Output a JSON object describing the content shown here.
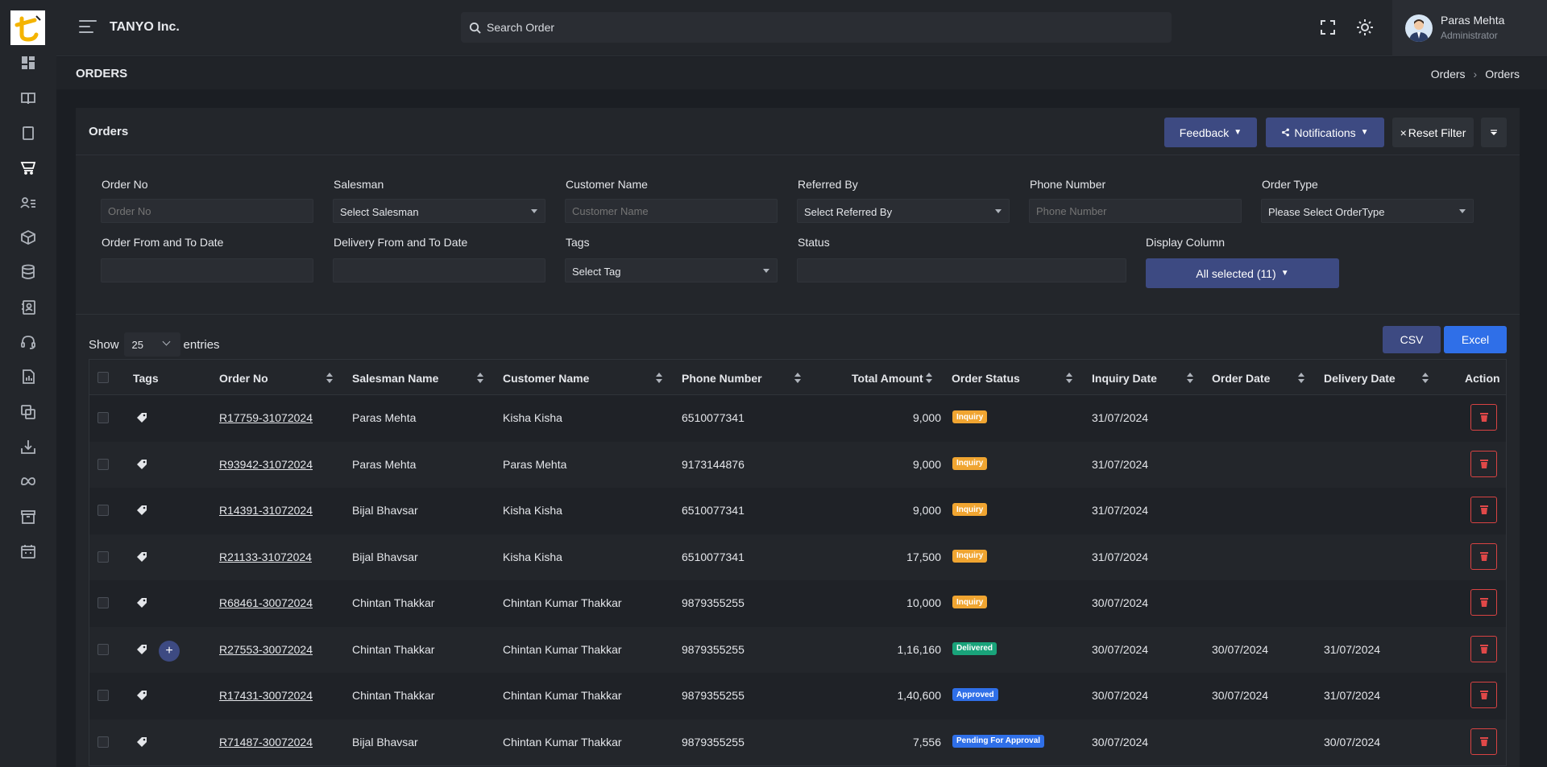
{
  "app": {
    "brand": "TANYO Inc."
  },
  "search": {
    "placeholder": "Search Order"
  },
  "user": {
    "name": "Paras Mehta",
    "role": "Administrator"
  },
  "page": {
    "title": "ORDERS",
    "breadcrumb": [
      "Orders",
      "Orders"
    ]
  },
  "card": {
    "title": "Orders",
    "feedback_label": "Feedback",
    "notifications_label": "Notifications",
    "reset_label": "Reset Filter",
    "reset_symbol": "×"
  },
  "filters": {
    "order_no": {
      "label": "Order No",
      "placeholder": "Order No"
    },
    "salesman": {
      "label": "Salesman",
      "value": "Select Salesman"
    },
    "customer_name": {
      "label": "Customer Name",
      "placeholder": "Customer Name"
    },
    "referred_by": {
      "label": "Referred By",
      "value": "Select Referred By"
    },
    "phone_number": {
      "label": "Phone Number",
      "placeholder": "Phone Number"
    },
    "order_type": {
      "label": "Order Type",
      "value": "Please Select OrderType"
    },
    "order_date": {
      "label": "Order From and To Date"
    },
    "delivery_date": {
      "label": "Delivery From and To Date"
    },
    "tags": {
      "label": "Tags",
      "value": "Select Tag"
    },
    "status": {
      "label": "Status"
    },
    "display_column": {
      "label": "Display Column",
      "value": "All selected (11)"
    }
  },
  "table_controls": {
    "show_label": "Show",
    "entries_value": "25",
    "entries_label": "entries",
    "csv_label": "CSV",
    "excel_label": "Excel"
  },
  "table": {
    "columns": [
      "Tags",
      "Order No",
      "Salesman Name",
      "Customer Name",
      "Phone Number",
      "Total Amount",
      "Order Status",
      "Inquiry Date",
      "Order Date",
      "Delivery Date",
      "Action"
    ],
    "rows": [
      {
        "order_no": "R17759-31072024",
        "salesman": "Paras Mehta",
        "customer": "Kisha Kisha",
        "phone": "6510077341",
        "amount": "9,000",
        "status": "Inquiry",
        "status_type": "inquiry",
        "inquiry_date": "31/07/2024",
        "order_date": "",
        "delivery_date": "",
        "has_plus": false
      },
      {
        "order_no": "R93942-31072024",
        "salesman": "Paras Mehta",
        "customer": "Paras Mehta",
        "phone": "9173144876",
        "amount": "9,000",
        "status": "Inquiry",
        "status_type": "inquiry",
        "inquiry_date": "31/07/2024",
        "order_date": "",
        "delivery_date": "",
        "has_plus": false
      },
      {
        "order_no": "R14391-31072024",
        "salesman": "Bijal Bhavsar",
        "customer": "Kisha Kisha",
        "phone": "6510077341",
        "amount": "9,000",
        "status": "Inquiry",
        "status_type": "inquiry",
        "inquiry_date": "31/07/2024",
        "order_date": "",
        "delivery_date": "",
        "has_plus": false
      },
      {
        "order_no": "R21133-31072024",
        "salesman": "Bijal Bhavsar",
        "customer": "Kisha Kisha",
        "phone": "6510077341",
        "amount": "17,500",
        "status": "Inquiry",
        "status_type": "inquiry",
        "inquiry_date": "31/07/2024",
        "order_date": "",
        "delivery_date": "",
        "has_plus": false
      },
      {
        "order_no": "R68461-30072024",
        "salesman": "Chintan Thakkar",
        "customer": "Chintan Kumar Thakkar",
        "phone": "9879355255",
        "amount": "10,000",
        "status": "Inquiry",
        "status_type": "inquiry",
        "inquiry_date": "30/07/2024",
        "order_date": "",
        "delivery_date": "",
        "has_plus": false
      },
      {
        "order_no": "R27553-30072024",
        "salesman": "Chintan Thakkar",
        "customer": "Chintan Kumar Thakkar",
        "phone": "9879355255",
        "amount": "1,16,160",
        "status": "Delivered",
        "status_type": "delivered",
        "inquiry_date": "30/07/2024",
        "order_date": "30/07/2024",
        "delivery_date": "31/07/2024",
        "has_plus": true
      },
      {
        "order_no": "R17431-30072024",
        "salesman": "Chintan Thakkar",
        "customer": "Chintan Kumar Thakkar",
        "phone": "9879355255",
        "amount": "1,40,600",
        "status": "Approved",
        "status_type": "approved",
        "inquiry_date": "30/07/2024",
        "order_date": "30/07/2024",
        "delivery_date": "31/07/2024",
        "has_plus": false
      },
      {
        "order_no": "R71487-30072024",
        "salesman": "Bijal Bhavsar",
        "customer": "Chintan Kumar Thakkar",
        "phone": "9879355255",
        "amount": "7,556",
        "status": "Pending For Approval",
        "status_type": "pending",
        "inquiry_date": "30/07/2024",
        "order_date": "",
        "delivery_date": "30/07/2024",
        "has_plus": false
      }
    ]
  },
  "sidebar": {
    "icons": [
      "dashboard-icon",
      "book-icon",
      "clipboard-icon",
      "cart-icon",
      "users-list-icon",
      "box-icon",
      "database-icon",
      "contacts-icon",
      "headset-icon",
      "report-icon",
      "copy-icon",
      "download-icon",
      "meta-icon",
      "archive-icon",
      "calendar-icon"
    ]
  },
  "colors": {
    "accent": "#3d4a82",
    "excel": "#2f6fe8",
    "inquiry": "#f0a531",
    "delivered": "#19a37a",
    "danger": "#d94343"
  }
}
